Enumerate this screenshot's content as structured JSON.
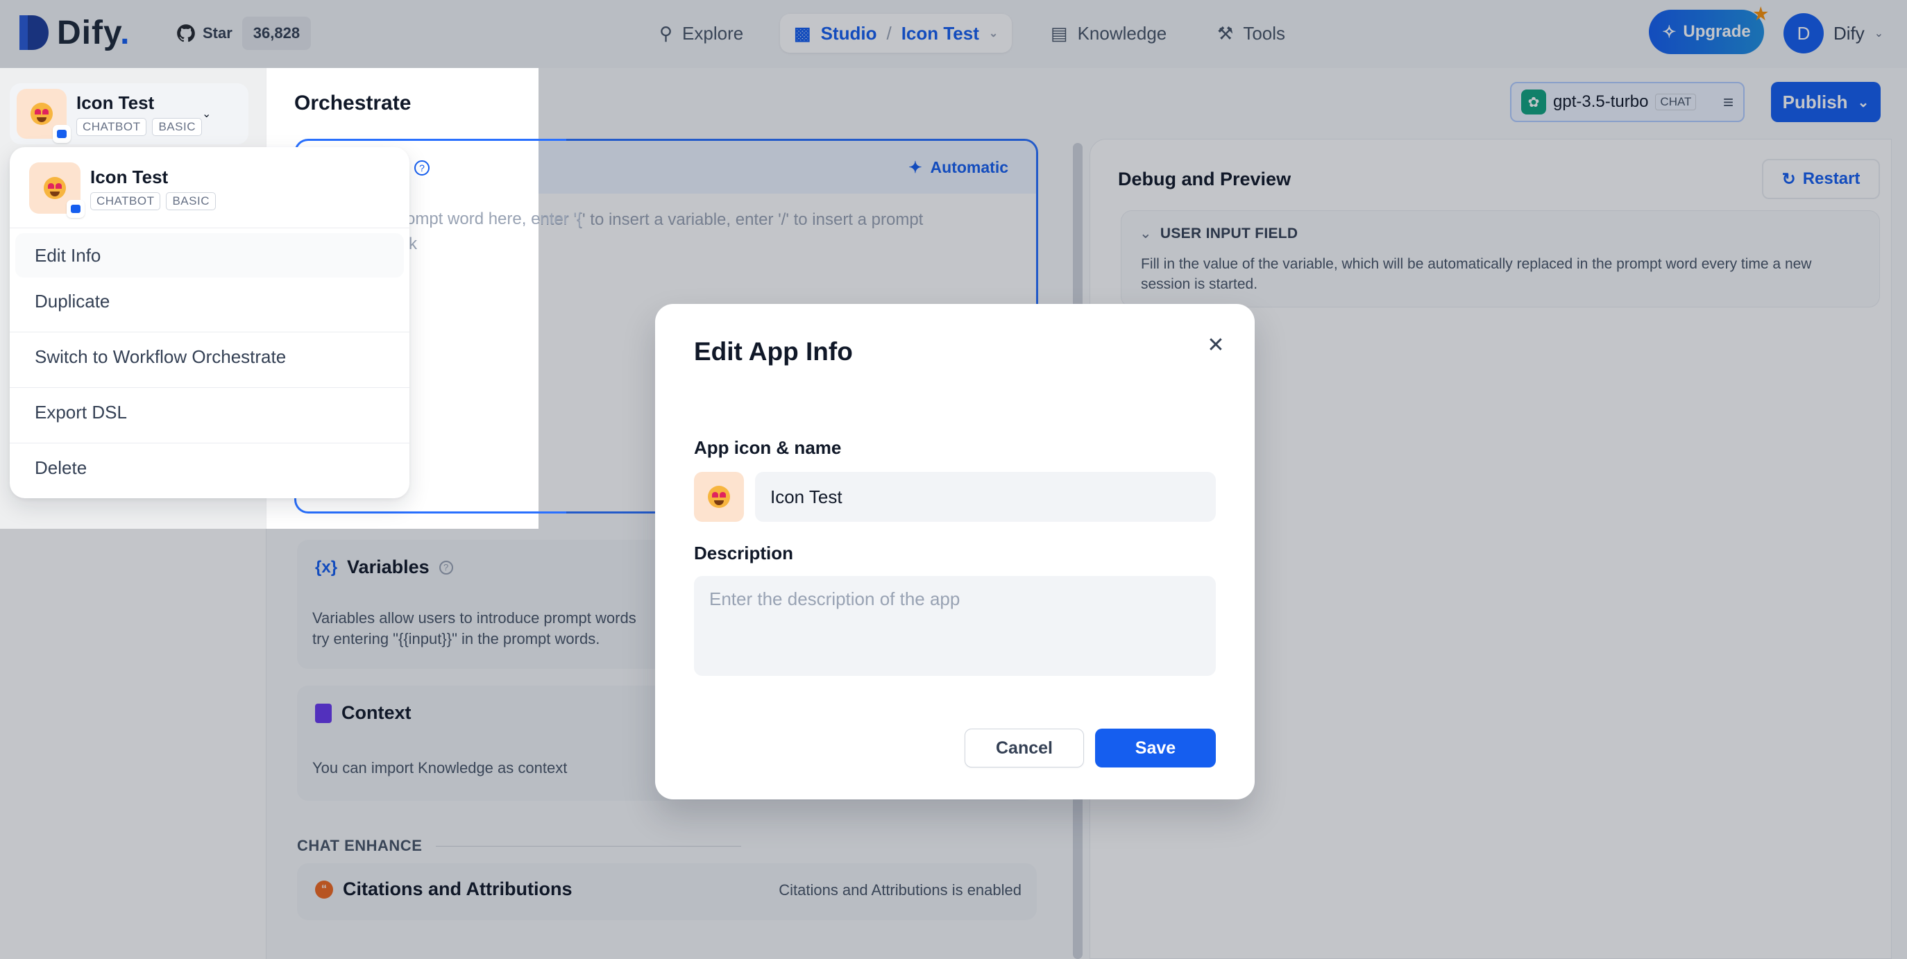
{
  "brand": {
    "name": "Dify",
    "dot": "."
  },
  "github": {
    "star_label": "Star",
    "count": "36,828"
  },
  "nav": {
    "explore": "Explore",
    "studio": "Studio",
    "separator": "/",
    "current_app": "Icon Test",
    "knowledge": "Knowledge",
    "tools": "Tools"
  },
  "upgrade_label": "Upgrade",
  "user": {
    "initial": "D",
    "name": "Dify"
  },
  "app": {
    "name": "Icon Test",
    "tags": [
      "CHATBOT",
      "BASIC"
    ]
  },
  "orchestrate": {
    "title": "Orchestrate",
    "model": {
      "name": "gpt-3.5-turbo",
      "mode": "CHAT"
    },
    "publish_label": "Publish",
    "prompt": {
      "automatic_label": "Automatic",
      "placeholder": "Write your prompt word here, enter '{' to insert a variable, enter '/' to insert a prompt content block",
      "placeholder_visible_line1": "rompt word here, enter '{' to insert a variable, enter '/' to insert a prompt",
      "placeholder_visible_line2": "ck",
      "overlay_fragment": "rompt word here, enter '{' to",
      "overlay_fragment_2": "ck"
    },
    "variables": {
      "title": "Variables",
      "body_line1": "Variables allow users to introduce prompt words",
      "body_line2": "try entering \"{{input}}\" in the prompt words."
    },
    "context": {
      "title": "Context",
      "body": "You can import Knowledge as context"
    },
    "enhance_label": "CHAT ENHANCE",
    "citations": {
      "title": "Citations and Attributions",
      "status": "Citations and Attributions is enabled"
    }
  },
  "debug": {
    "title": "Debug and Preview",
    "restart_label": "Restart",
    "user_input": {
      "title": "USER INPUT FIELD",
      "body": "Fill in the value of the variable, which will be automatically replaced in the prompt word every time a new session is started."
    }
  },
  "menu": {
    "items": [
      "Edit Info",
      "Duplicate",
      "Switch to Workflow Orchestrate",
      "Export DSL",
      "Delete"
    ]
  },
  "modal": {
    "title": "Edit App Info",
    "icon_name_label": "App icon & name",
    "name_value": "Icon Test",
    "description_label": "Description",
    "description_placeholder": "Enter the description of the app",
    "cancel_label": "Cancel",
    "save_label": "Save"
  },
  "colors": {
    "primary": "#155eef",
    "app_icon_bg": "#fde3cf",
    "upgrade_star": "#f79009"
  }
}
